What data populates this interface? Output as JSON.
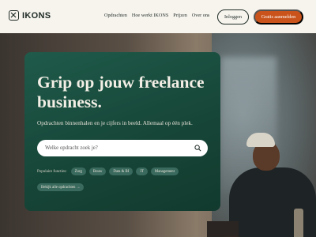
{
  "brand": {
    "name": "IKONS"
  },
  "nav": {
    "links": [
      "Opdrachten",
      "Hoe werkt IKONS",
      "Prijzen",
      "Over ons"
    ],
    "login_label": "Inloggen",
    "signup_label": "Gratis aanmelden"
  },
  "hero": {
    "headline": "Grip op jouw freelance business.",
    "subline": "Opdrachten binnenhalen en je cijfers in beeld. Allemaal op één plek.",
    "search_placeholder": "Welke opdracht zoek je?",
    "popular_label": "Populaire functies:",
    "chips": [
      "Zorg",
      "Bouw",
      "Data & BI",
      "IT",
      "Management"
    ],
    "all_link": "Bekijk alle opdrachten →"
  },
  "colors": {
    "accent": "#c9531b",
    "panel": "#1f5a4a",
    "background": "#f7f4ee"
  }
}
